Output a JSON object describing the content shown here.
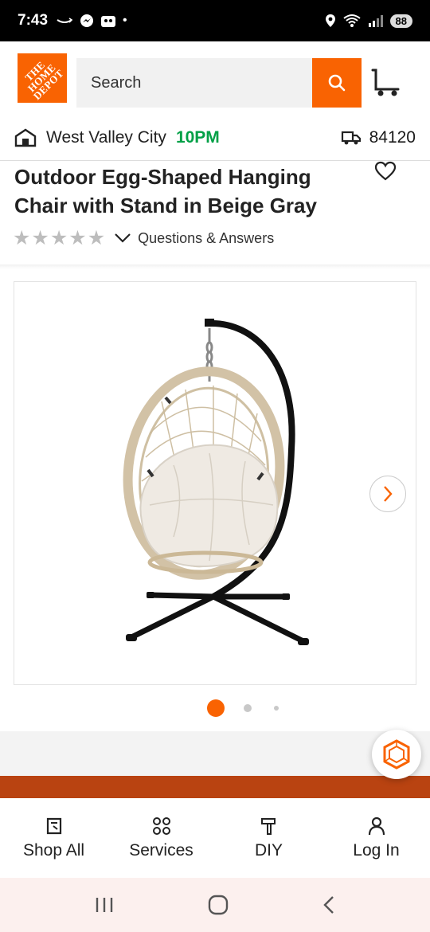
{
  "status_bar": {
    "time": "7:43",
    "battery": "88"
  },
  "header": {
    "logo_text": "THE HOME DEPOT",
    "search": {
      "placeholder": "Search"
    }
  },
  "location": {
    "store": "West Valley City",
    "hours": "10PM",
    "zip": "84120"
  },
  "product": {
    "title": "Outdoor Egg-Shaped Hanging Chair with Stand in Beige Gray",
    "rating_stars": 0,
    "qa_label": "Questions & Answers"
  },
  "gallery": {
    "current_index": 0,
    "total": 3
  },
  "colors": {
    "brand_orange": "#f96302",
    "hours_green": "#00a046",
    "band_orange": "#b94311"
  },
  "bottom_nav": [
    {
      "label": "Shop All",
      "icon": "shop-all-icon"
    },
    {
      "label": "Services",
      "icon": "services-icon"
    },
    {
      "label": "DIY",
      "icon": "diy-icon"
    },
    {
      "label": "Log In",
      "icon": "user-icon"
    }
  ]
}
